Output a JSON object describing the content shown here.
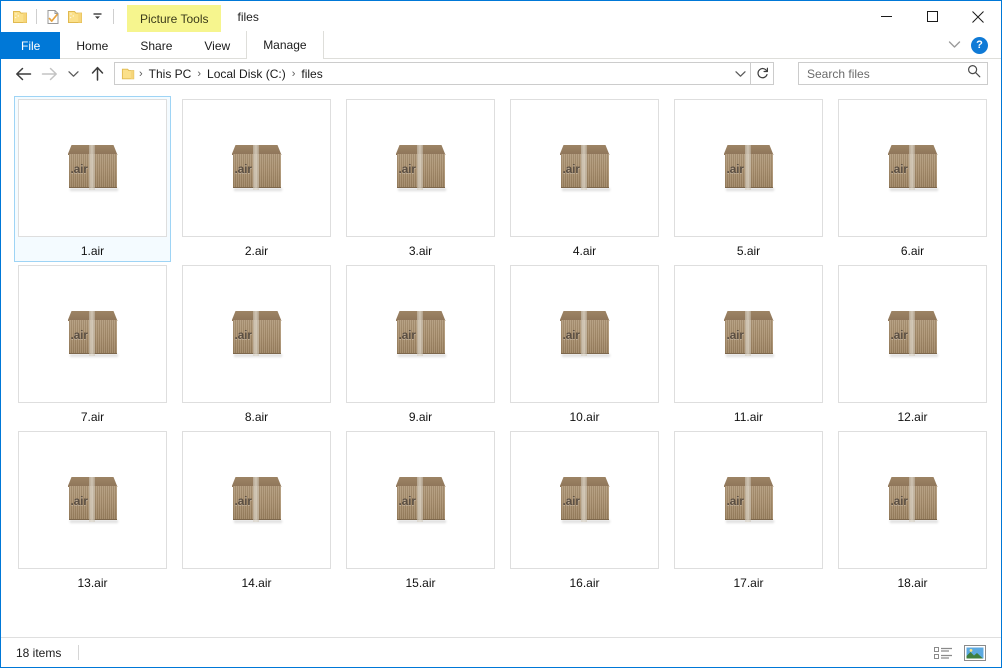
{
  "window": {
    "title": "files",
    "contextual_tab_header": "Picture Tools"
  },
  "quick_access": [
    {
      "name": "folder-icon",
      "label": "Folder"
    },
    {
      "name": "properties-icon",
      "label": "Properties"
    },
    {
      "name": "new-folder-icon",
      "label": "New folder"
    },
    {
      "name": "chevron-down-icon",
      "label": "Customize Quick Access Toolbar"
    }
  ],
  "caption_buttons": {
    "minimize": "Minimize",
    "maximize": "Maximize",
    "close": "Close"
  },
  "ribbon": {
    "tabs": [
      {
        "label": "File",
        "active": true
      },
      {
        "label": "Home",
        "active": false
      },
      {
        "label": "Share",
        "active": false
      },
      {
        "label": "View",
        "active": false
      },
      {
        "label": "Manage",
        "active": false
      }
    ],
    "collapse_label": "Minimize the Ribbon",
    "help_label": "?"
  },
  "address": {
    "back_label": "Back",
    "forward_label": "Forward",
    "recent_label": "Recent locations",
    "up_label": "Up",
    "breadcrumbs": [
      "This PC",
      "Local Disk (C:)",
      "files"
    ],
    "separator": "›",
    "dropdown_label": "Previous Locations",
    "refresh_label": "Refresh"
  },
  "search": {
    "placeholder": "Search files",
    "value": "",
    "icon": "search-icon"
  },
  "files": [
    {
      "name": "1.air",
      "ext": ".air",
      "selected": true
    },
    {
      "name": "2.air",
      "ext": ".air",
      "selected": false
    },
    {
      "name": "3.air",
      "ext": ".air",
      "selected": false
    },
    {
      "name": "4.air",
      "ext": ".air",
      "selected": false
    },
    {
      "name": "5.air",
      "ext": ".air",
      "selected": false
    },
    {
      "name": "6.air",
      "ext": ".air",
      "selected": false
    },
    {
      "name": "7.air",
      "ext": ".air",
      "selected": false
    },
    {
      "name": "8.air",
      "ext": ".air",
      "selected": false
    },
    {
      "name": "9.air",
      "ext": ".air",
      "selected": false
    },
    {
      "name": "10.air",
      "ext": ".air",
      "selected": false
    },
    {
      "name": "11.air",
      "ext": ".air",
      "selected": false
    },
    {
      "name": "12.air",
      "ext": ".air",
      "selected": false
    },
    {
      "name": "13.air",
      "ext": ".air",
      "selected": false
    },
    {
      "name": "14.air",
      "ext": ".air",
      "selected": false
    },
    {
      "name": "15.air",
      "ext": ".air",
      "selected": false
    },
    {
      "name": "16.air",
      "ext": ".air",
      "selected": false
    },
    {
      "name": "17.air",
      "ext": ".air",
      "selected": false
    },
    {
      "name": "18.air",
      "ext": ".air",
      "selected": false
    }
  ],
  "status": {
    "item_count": "18 items",
    "view_details_label": "Details view",
    "view_large_icons_label": "Large icons view",
    "active_view": "large-icons"
  },
  "colors": {
    "accent": "#0078d7",
    "contextual_tab": "#f6f58e",
    "selection_border": "#9ed4f5",
    "selection_fill": "#f4fbff",
    "tile_border": "#dedede",
    "box_icon": "#a98f6d"
  }
}
